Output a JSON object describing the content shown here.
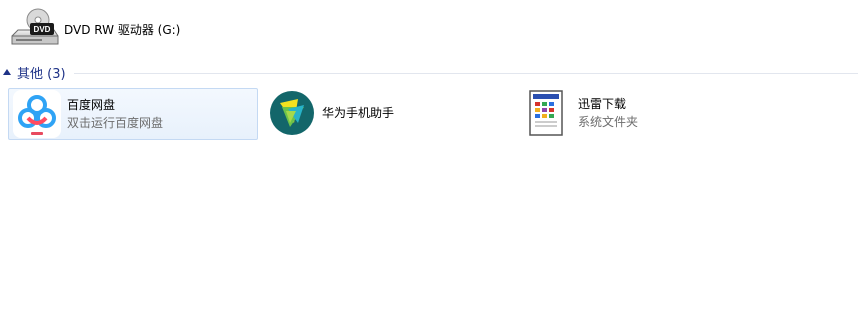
{
  "drive": {
    "label": "DVD RW 驱动器 (G:)",
    "icon": "dvd-drive-icon"
  },
  "group": {
    "title": "其他 (3)"
  },
  "items": [
    {
      "name": "百度网盘",
      "sub": "双击运行百度网盘",
      "icon": "baidu-netdisk-icon",
      "selected": true
    },
    {
      "name": "华为手机助手",
      "sub": "",
      "icon": "huawei-hisuite-icon",
      "selected": false
    },
    {
      "name": "迅雷下载",
      "sub": "系统文件夹",
      "icon": "system-folder-icon",
      "selected": false
    }
  ],
  "colors": {
    "group_header": "#1e3287",
    "selection_border": "#c4d9f3",
    "secondary_text": "#6d6d6d"
  }
}
